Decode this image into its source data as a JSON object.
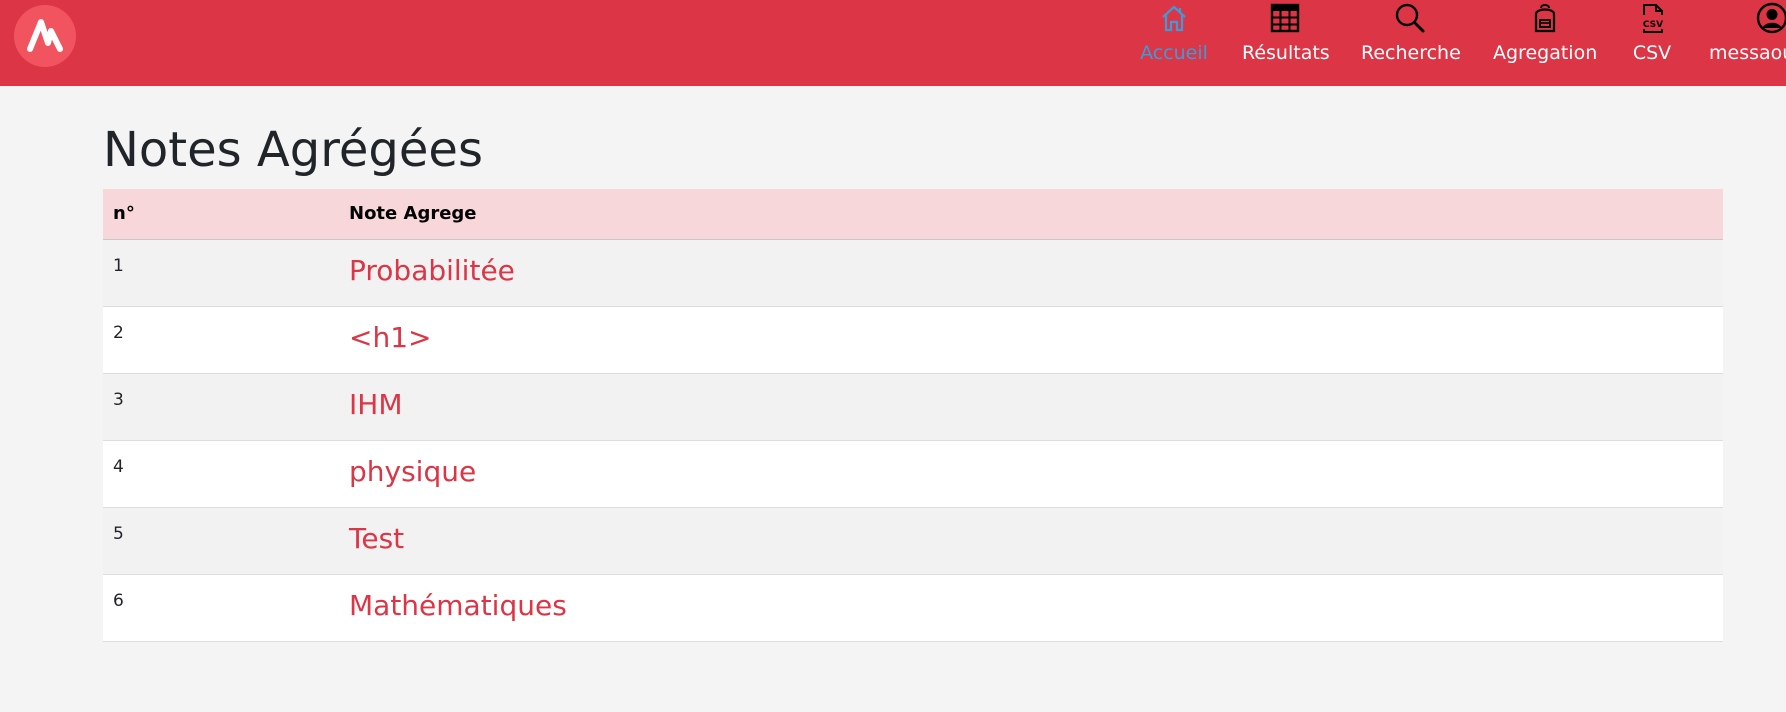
{
  "nav": {
    "logo_icon": "app-logo",
    "items": [
      {
        "id": "accueil",
        "label": "Accueil",
        "icon": "home-icon",
        "active": true
      },
      {
        "id": "resultats",
        "label": "Résultats",
        "icon": "table-icon",
        "active": false
      },
      {
        "id": "recherche",
        "label": "Recherche",
        "icon": "search-icon",
        "active": false
      },
      {
        "id": "agregation",
        "label": "Agregation",
        "icon": "backpack-icon",
        "active": false
      },
      {
        "id": "csv",
        "label": "CSV",
        "icon": "csv-file-icon",
        "active": false
      },
      {
        "id": "user",
        "label": "messaou",
        "icon": "user-circle-icon",
        "active": false
      }
    ],
    "colors": {
      "background": "#dc3545",
      "active": "#3d9bd9",
      "text": "#ffffff"
    }
  },
  "page": {
    "title": "Notes Agrégées"
  },
  "table": {
    "headers": [
      "n°",
      "Note Agrege"
    ],
    "rows": [
      {
        "num": "1",
        "note": "Probabilitée"
      },
      {
        "num": "2",
        "note": "<h1>"
      },
      {
        "num": "3",
        "note": "IHM"
      },
      {
        "num": "4",
        "note": "physique"
      },
      {
        "num": "5",
        "note": "Test"
      },
      {
        "num": "6",
        "note": "Mathématiques"
      }
    ],
    "colors": {
      "header_bg": "#f8d7da",
      "link": "#dc3545"
    }
  }
}
